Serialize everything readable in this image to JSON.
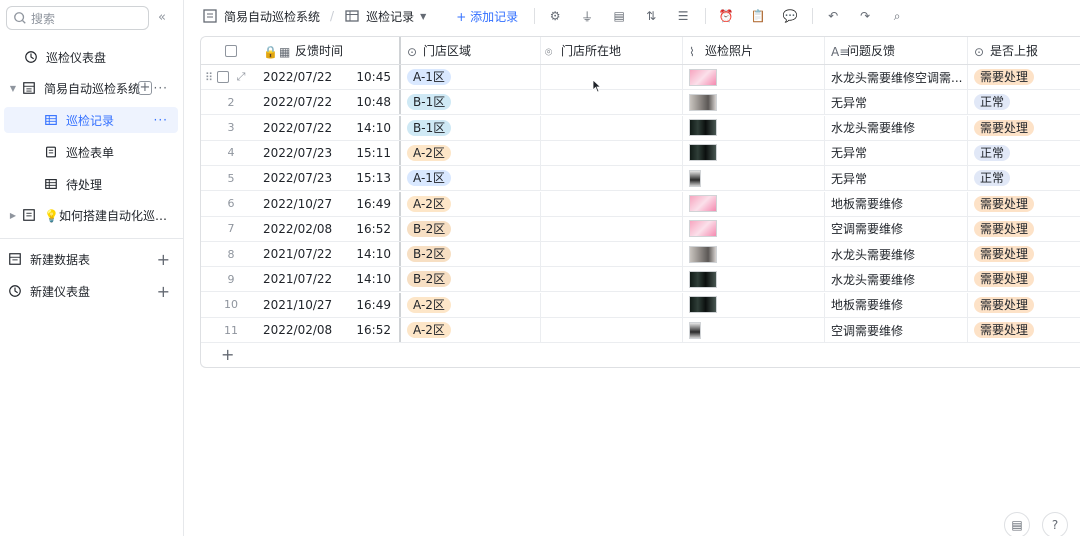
{
  "sidebar": {
    "search_placeholder": "搜索",
    "items": [
      {
        "label": "巡检仪表盘"
      },
      {
        "label": "简易自动巡检系统"
      },
      {
        "label": "巡检记录"
      },
      {
        "label": "巡检表单"
      },
      {
        "label": "待处理"
      },
      {
        "label": "💡如何搭建自动化巡检..."
      }
    ],
    "new_table": "新建数据表",
    "new_dashboard": "新建仪表盘"
  },
  "toolbar": {
    "base_name": "简易自动巡检系统",
    "view_name": "巡检记录",
    "add_record": "+ 添加记录"
  },
  "grid": {
    "headers": {
      "time": "反馈时间",
      "area": "门店区域",
      "location": "门店所在地",
      "photo": "巡检照片",
      "issue": "问题反馈",
      "report": "是否上报"
    },
    "rows": [
      {
        "idx": "1",
        "date": "2022/07/22",
        "time": "10:45",
        "area": "A-1区",
        "photo": "pink",
        "issue": "水龙头需要维修空调需...",
        "report": "需要处理"
      },
      {
        "idx": "2",
        "date": "2022/07/22",
        "time": "10:48",
        "area": "B-1区",
        "photo": "face",
        "issue": "无异常",
        "report": "正常"
      },
      {
        "idx": "3",
        "date": "2022/07/22",
        "time": "14:10",
        "area": "B-1区",
        "photo": "dark",
        "issue": "水龙头需要维修",
        "report": "需要处理"
      },
      {
        "idx": "4",
        "date": "2022/07/23",
        "time": "15:11",
        "area": "A-2区",
        "photo": "dark",
        "issue": "无异常",
        "report": "正常"
      },
      {
        "idx": "5",
        "date": "2022/07/23",
        "time": "15:13",
        "area": "A-1区",
        "photo": "small",
        "issue": "无异常",
        "report": "正常"
      },
      {
        "idx": "6",
        "date": "2022/10/27",
        "time": "16:49",
        "area": "A-2区",
        "photo": "pink",
        "issue": "地板需要维修",
        "report": "需要处理"
      },
      {
        "idx": "7",
        "date": "2022/02/08",
        "time": "16:52",
        "area": "B-2区",
        "photo": "pink",
        "issue": "空调需要维修",
        "report": "需要处理"
      },
      {
        "idx": "8",
        "date": "2021/07/22",
        "time": "14:10",
        "area": "B-2区",
        "photo": "face",
        "issue": "水龙头需要维修",
        "report": "需要处理"
      },
      {
        "idx": "9",
        "date": "2021/07/22",
        "time": "14:10",
        "area": "B-2区",
        "photo": "dark",
        "issue": "水龙头需要维修",
        "report": "需要处理"
      },
      {
        "idx": "10",
        "date": "2021/10/27",
        "time": "16:49",
        "area": "A-2区",
        "photo": "dark",
        "issue": "地板需要维修",
        "report": "需要处理"
      },
      {
        "idx": "11",
        "date": "2022/02/08",
        "time": "16:52",
        "area": "A-2区",
        "photo": "small",
        "issue": "空调需要维修",
        "report": "需要处理"
      }
    ]
  },
  "colors": {
    "accent": "#3370ff",
    "active_bg": "#eef3fe"
  }
}
